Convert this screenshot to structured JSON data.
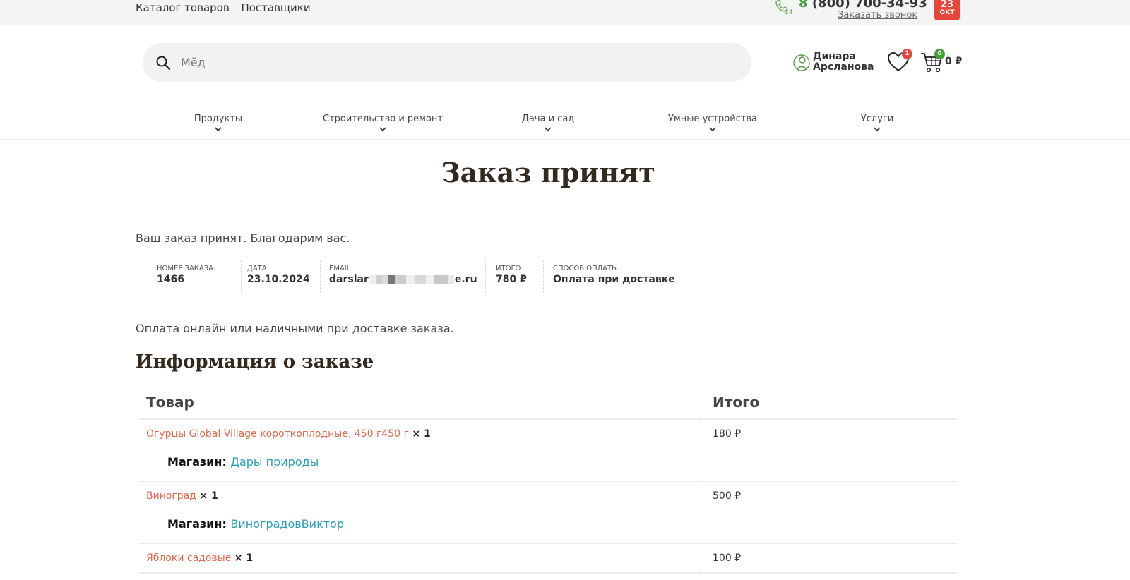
{
  "topbar": {
    "nav": [
      "Каталог товаров",
      "Поставщики"
    ],
    "phone_prefix": "8",
    "phone_number": "(800) 700-34-93",
    "callback": "Заказать звонок",
    "date_day": "23",
    "date_month": "ОКТ",
    "support_icon": "phone-24-icon"
  },
  "header": {
    "search_value": "Мёд",
    "user_first": "Динара",
    "user_last": "Арсланова",
    "wishlist_count": "1",
    "cart_count": "0",
    "cart_sum": "0 ₽"
  },
  "categories": [
    "Продукты",
    "Строительство и ремонт",
    "Дача и сад",
    "Умные устройства",
    "Услуги"
  ],
  "page": {
    "title": "Заказ принят",
    "thanks": "Ваш заказ принят. Благодарим вас.",
    "overview": {
      "order_label": "НОМЕР ЗАКАЗА:",
      "order_value": "1466",
      "date_label": "ДАТА:",
      "date_value": "23.10.2024",
      "email_label": "EMAIL:",
      "email_start": "darslar",
      "email_end": "e.ru",
      "total_label": "ИТОГО:",
      "total_value": "780 ₽",
      "method_label": "СПОСОБ ОПЛАТЫ:",
      "method_value": "Оплата при доставке"
    },
    "payment_note": "Оплата онлайн или наличными при доставке заказа.",
    "section_title": "Информация о заказе",
    "table": {
      "col_product": "Товар",
      "col_total": "Итого",
      "vendor_label": "Магазин:",
      "rows": [
        {
          "name": "Огурцы Global Village короткоплодные, 450 г450 г",
          "qty": "× 1",
          "vendor": "Дары природы",
          "total": "180 ₽"
        },
        {
          "name": "Виноград",
          "qty": "× 1",
          "vendor": "ВиноградовВиктор",
          "total": "500 ₽"
        },
        {
          "name": "Яблоки садовые",
          "qty": "× 1",
          "vendor": "",
          "total": "100 ₽"
        }
      ]
    }
  },
  "colors": {
    "accent_green": "#45a03a",
    "accent_red": "#e8463b",
    "link_orange": "#e06a4f",
    "vendor_link": "#2aa0b8"
  }
}
